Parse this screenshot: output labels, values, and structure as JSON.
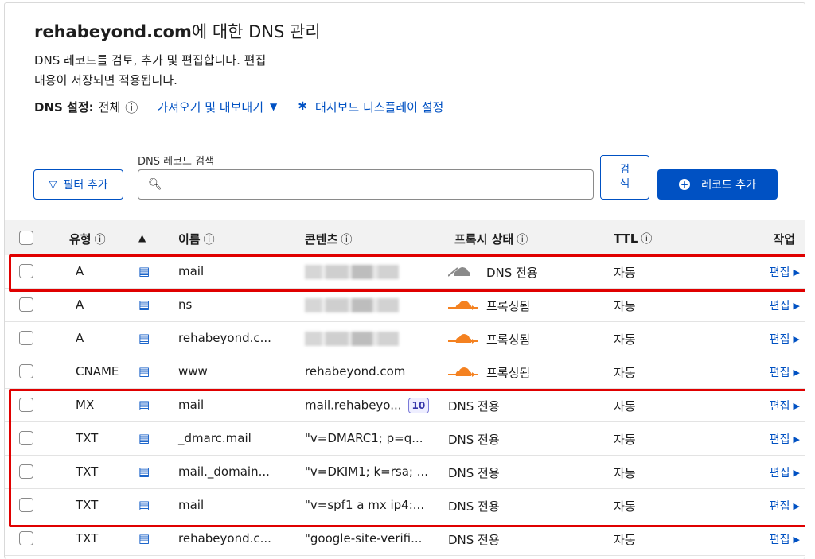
{
  "header": {
    "domain": "rehabeyond.com",
    "title_suffix": "에 대한 DNS 관리",
    "description_line1": "DNS 레코드를 검토, 추가 및 편집합니다. 편집",
    "description_line2": "내용이 저장되면 적용됩니다."
  },
  "settings": {
    "label": "DNS 설정:",
    "value": "전체",
    "info_glyph": "ⓘ",
    "import_export_label": "가져오기 및 내보내기",
    "dashboard_display_label": "대시보드 디스플레이 설정"
  },
  "toolbar": {
    "filter_label": "필터 추가",
    "search_label": "DNS 레코드 검색",
    "search_value": "",
    "search_button_line1": "검",
    "search_button_line2": "색",
    "add_record_label": "레코드 추가"
  },
  "table": {
    "headers": {
      "type": "유형",
      "name": "이름",
      "content": "콘텐츠",
      "proxy": "프록시 상태",
      "ttl": "TTL",
      "actions": "작업"
    },
    "rows": [
      {
        "type": "A",
        "name": "mail",
        "content": "",
        "content_redacted": true,
        "proxy": "DNS 전용",
        "proxy_icon": "gray-cloud-icon",
        "ttl": "자동",
        "action": "편집"
      },
      {
        "type": "A",
        "name": "ns",
        "content": "",
        "content_redacted": true,
        "proxy": "프록싱됨",
        "proxy_icon": "orange-cloud-icon",
        "ttl": "자동",
        "action": "편집"
      },
      {
        "type": "A",
        "name": "rehabeyond.c...",
        "content": "",
        "content_redacted": true,
        "proxy": "프록싱됨",
        "proxy_icon": "orange-cloud-icon",
        "ttl": "자동",
        "action": "편집"
      },
      {
        "type": "CNAME",
        "name": "www",
        "content": "rehabeyond.com",
        "proxy": "프록싱됨",
        "proxy_icon": "orange-cloud-icon",
        "ttl": "자동",
        "action": "편집"
      },
      {
        "type": "MX",
        "name": "mail",
        "content": "mail.rehabeyo...",
        "priority": "10",
        "proxy": "DNS 전용",
        "ttl": "자동",
        "action": "편집"
      },
      {
        "type": "TXT",
        "name": "_dmarc.mail",
        "content": "\"v=DMARC1; p=q...",
        "proxy": "DNS 전용",
        "ttl": "자동",
        "action": "편집"
      },
      {
        "type": "TXT",
        "name": "mail._domain...",
        "content": "\"v=DKIM1; k=rsa; ...",
        "proxy": "DNS 전용",
        "ttl": "자동",
        "action": "편집"
      },
      {
        "type": "TXT",
        "name": "mail",
        "content": "\"v=spf1 a mx ip4:...",
        "proxy": "DNS 전용",
        "ttl": "자동",
        "action": "편집"
      },
      {
        "type": "TXT",
        "name": "rehabeyond.c...",
        "content": "\"google-site-verifi...",
        "proxy": "DNS 전용",
        "ttl": "자동",
        "action": "편집"
      }
    ]
  },
  "colors": {
    "link": "#0051c3",
    "highlight": "#e00000",
    "proxied": "#f48120",
    "dns_only": "#8a8a8a"
  }
}
